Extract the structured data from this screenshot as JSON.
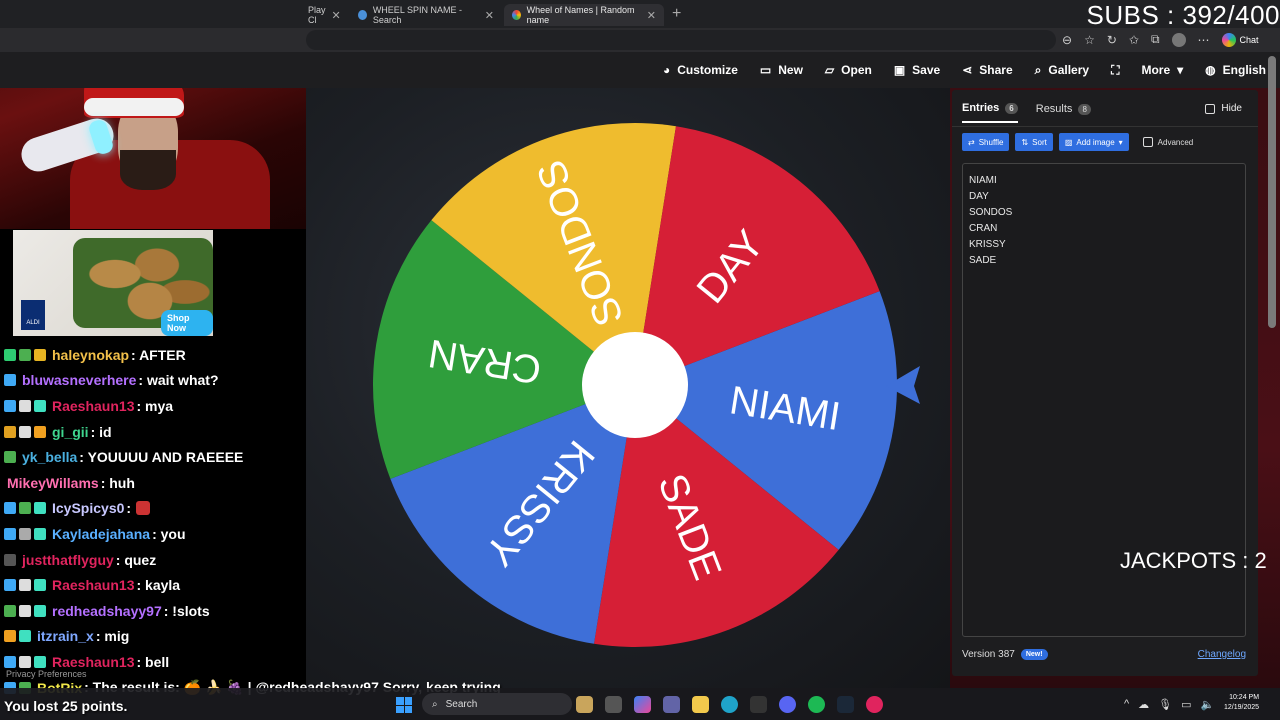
{
  "browser": {
    "tabs": [
      {
        "label": "Play Cl",
        "icon_color": "#3b82f6"
      },
      {
        "label": "WHEEL SPIN NAME - Search",
        "icon_color": "#4a90d9"
      },
      {
        "label": "Wheel of Names | Random name",
        "icon_color": "#ea4335"
      }
    ],
    "chat_label": "Chat"
  },
  "toolbar": {
    "items": [
      {
        "label": "Customize",
        "icon": "palette-icon",
        "glyph": "🎨"
      },
      {
        "label": "New",
        "icon": "new-file-icon",
        "glyph": "🗋"
      },
      {
        "label": "Open",
        "icon": "folder-icon",
        "glyph": "📂"
      },
      {
        "label": "Save",
        "icon": "save-icon",
        "glyph": "💾"
      },
      {
        "label": "Share",
        "icon": "share-icon",
        "glyph": "⤴"
      },
      {
        "label": "Gallery",
        "icon": "search-icon",
        "glyph": "🔍"
      },
      {
        "label": "",
        "icon": "fullscreen-icon",
        "glyph": "⛶"
      },
      {
        "label": "More",
        "icon": "chevron-down-icon",
        "glyph": "▾"
      },
      {
        "label": "English",
        "icon": "globe-icon",
        "glyph": "🌐"
      }
    ]
  },
  "wheel": {
    "segments": [
      {
        "name": "NIAMI",
        "color": "#3e6fd8"
      },
      {
        "name": "SADE",
        "color": "#d61f36"
      },
      {
        "name": "KRISSY",
        "color": "#3e6fd8"
      },
      {
        "name": "CRAN",
        "color": "#2f9e3c"
      },
      {
        "name": "SONDOS",
        "color": "#efbc2e"
      },
      {
        "name": "DAY",
        "color": "#d61f36"
      }
    ],
    "pointer_color": "#3e6fd8"
  },
  "panel": {
    "tabs": [
      {
        "label": "Entries",
        "count": "6"
      },
      {
        "label": "Results",
        "count": "8"
      }
    ],
    "hide_label": "Hide",
    "buttons": {
      "shuffle": "Shuffle",
      "sort": "Sort",
      "add_image": "Add image",
      "advanced": "Advanced"
    },
    "entries": [
      "NIAMI",
      "DAY",
      "SONDOS",
      "CRAN",
      "KRISSY",
      "SADE"
    ],
    "version": "Version 387",
    "new_badge": "New!",
    "changelog": "Changelog"
  },
  "overlay": {
    "subs": "SUBS : 392/400",
    "jackpots": "JACKPOTS : 2"
  },
  "ad": {
    "brand": "ALDI",
    "button": "Shop Now"
  },
  "chat": {
    "messages": [
      {
        "user": "haleynokap",
        "color": "#f2c04a",
        "text": " : AFTER",
        "badges": [
          "#2ecc71",
          "#4caf50",
          "#e6b422"
        ]
      },
      {
        "user": "bluwasneverhere",
        "color": "#b470ff",
        "text": " : wait what?",
        "badges": [
          "#3fa9f5"
        ]
      },
      {
        "user": "Raeshaun13",
        "color": "#e0245e",
        "text": " : mya",
        "badges": [
          "#3fa9f5",
          "#ddd",
          "#3fe0c0"
        ]
      },
      {
        "user": "gi_gii",
        "color": "#3fd68f",
        "text": " : id",
        "badges": [
          "#e0a020",
          "#ddd",
          "#f0a020"
        ]
      },
      {
        "user": "yk_bella",
        "color": "#4ab0e0",
        "text": " : YOUUUU AND RAEEEE",
        "badges": [
          "#4caf50"
        ]
      },
      {
        "user": "MikeyWillams",
        "color": "#ff6fb0",
        "text": " : huh",
        "badges": []
      },
      {
        "user": "IcySpicys0",
        "color": "#c8c8ff",
        "text": " : ",
        "badges": [
          "#3fa9f5",
          "#4caf50",
          "#3fe0c0"
        ],
        "emote": true
      },
      {
        "user": "Kayladejahana",
        "color": "#5ab0ff",
        "text": " : you",
        "badges": [
          "#3fa9f5",
          "#aaa",
          "#3fe0c0"
        ]
      },
      {
        "user": "justthatflyguy",
        "color": "#e0245e",
        "text": " : quez",
        "badges": [
          "#555"
        ]
      },
      {
        "user": "Raeshaun13",
        "color": "#e0245e",
        "text": " : kayla",
        "badges": [
          "#3fa9f5",
          "#ddd",
          "#3fe0c0"
        ]
      },
      {
        "user": "redheadshayy97",
        "color": "#b470ff",
        "text": " : !slots",
        "badges": [
          "#4caf50",
          "#ddd",
          "#3fe0c0"
        ]
      },
      {
        "user": "itzrain_x",
        "color": "#7fa8ff",
        "text": " : mig",
        "badges": [
          "#f0a020",
          "#3fe0c0"
        ]
      },
      {
        "user": "Raeshaun13",
        "color": "#e0245e",
        "text": " : bell",
        "badges": [
          "#3fa9f5",
          "#ddd",
          "#3fe0c0"
        ]
      },
      {
        "user": "BotRix",
        "color": "#f2e94a",
        "text": " : The result is: 🍊 🍌 🍇 | @redheadshayy97 Sorry, keep trying",
        "badges": [
          "#3fa9f5",
          "#4caf50"
        ]
      }
    ],
    "privacy": "Privacy Preferences",
    "lost_text": "You lost 25 points."
  },
  "taskbar": {
    "search": "Search",
    "time": "10:24 PM",
    "date": "12/19/2025"
  }
}
